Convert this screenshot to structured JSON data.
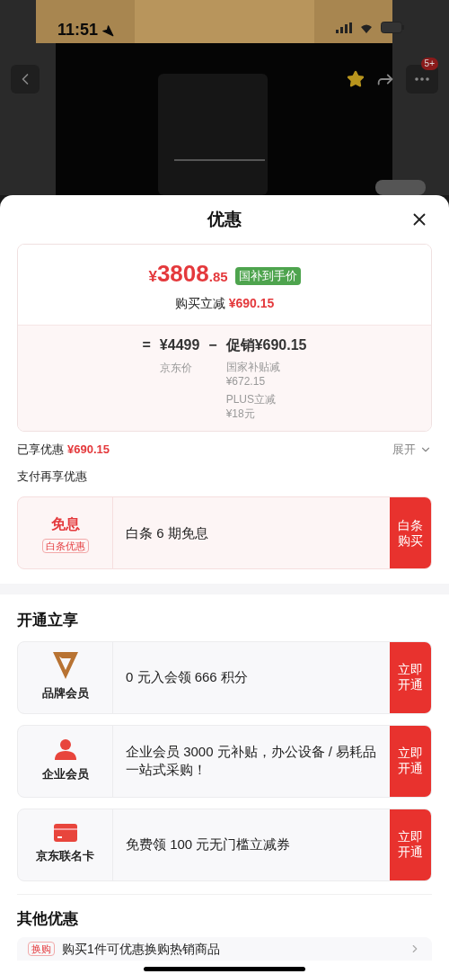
{
  "status_bar": {
    "time": "11:51"
  },
  "product_header": {
    "badge": "5+",
    "favorited": true
  },
  "sheet": {
    "title": "优惠",
    "price_card": {
      "currency": "¥",
      "price_int": "3808",
      "price_dec": ".85",
      "tag": "国补到手价",
      "discount_label": "购买立减",
      "discount_value": "¥690.15",
      "formula": {
        "equals": "=",
        "base": "¥4499",
        "minus": "−",
        "promo": "促销¥690.15",
        "base_label": "京东价",
        "items": [
          {
            "name": "国家补贴减",
            "value": "¥672.15"
          },
          {
            "name": "PLUS立减",
            "value": "¥18元"
          }
        ]
      }
    },
    "enjoyed": {
      "label": "已享优惠",
      "value": "¥690.15",
      "toggle": "展开",
      "expanded": false
    },
    "pay_title": "支付再享优惠",
    "pay_offers": [
      {
        "title": "免息",
        "tag": "白条优惠",
        "desc": "白条 6 期免息",
        "action": "白条购买"
      }
    ],
    "member_title": "开通立享",
    "member_offers": [
      {
        "kind": "brand",
        "name": "品牌会员",
        "desc": "0 元入会领 666 积分",
        "action": "立即开通"
      },
      {
        "kind": "enterprise",
        "name": "企业会员",
        "desc": "企业会员 3000 元补贴，办公设备 / 易耗品一站式采购！",
        "action": "立即开通"
      },
      {
        "kind": "card",
        "name": "京东联名卡",
        "desc": "免费领 100 元无门槛立减券",
        "action": "立即开通"
      }
    ],
    "other_title": "其他优惠",
    "other_offers": [
      {
        "tag": "换购",
        "text": "购买1件可优惠换购热销商品"
      }
    ]
  }
}
